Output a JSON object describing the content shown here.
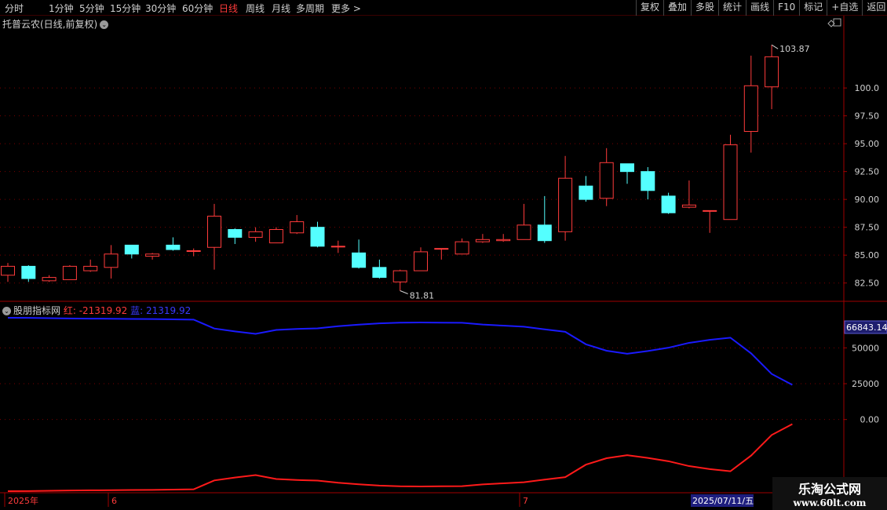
{
  "toolbar": {
    "periods": [
      {
        "label": "分时",
        "active": false
      },
      {
        "label": "1分钟",
        "active": false
      },
      {
        "label": "5分钟",
        "active": false
      },
      {
        "label": "15分钟",
        "active": false
      },
      {
        "label": "30分钟",
        "active": false
      },
      {
        "label": "60分钟",
        "active": false
      },
      {
        "label": "日线",
        "active": true
      },
      {
        "label": "周线",
        "active": false
      },
      {
        "label": "月线",
        "active": false
      },
      {
        "label": "多周期",
        "active": false
      },
      {
        "label": "更多 >",
        "active": false
      }
    ],
    "buttons": [
      "复权",
      "叠加",
      "多股",
      "统计",
      "画线",
      "F10",
      "标记",
      "+自选",
      "返回"
    ]
  },
  "main_title": "托普云农(日线,前复权)",
  "sub_title": {
    "name": "股朋指标网",
    "red_label": "红: -21319.92",
    "blue_label": "蓝: 21319.92"
  },
  "watermark": {
    "line1": "乐淘公式网",
    "line2": "www.60lt.com"
  },
  "colors": {
    "up": "#ff3b3b",
    "down": "#54ffff",
    "blue_line": "#1a1aff",
    "red_line": "#ff1a1a",
    "grid": "#7a0000"
  },
  "chart_data": [
    {
      "type": "candlestick",
      "title": "托普云农(日线,前复权)",
      "ylim": [
        81.0,
        105.5
      ],
      "y_ticks": [
        "100.0",
        "97.50",
        "95.00",
        "92.50",
        "90.00",
        "87.50",
        "85.00",
        "82.50"
      ],
      "high_label": "103.87",
      "low_label": "81.81",
      "candles": [
        {
          "o": 83.2,
          "c": 84.0,
          "h": 84.3,
          "l": 82.6
        },
        {
          "o": 84.0,
          "c": 82.9,
          "h": 84.1,
          "l": 82.6
        },
        {
          "o": 82.7,
          "c": 83.0,
          "h": 83.2,
          "l": 82.6
        },
        {
          "o": 82.8,
          "c": 84.0,
          "h": 84.1,
          "l": 82.8
        },
        {
          "o": 83.6,
          "c": 84.0,
          "h": 84.6,
          "l": 83.5
        },
        {
          "o": 83.9,
          "c": 85.1,
          "h": 85.9,
          "l": 82.9
        },
        {
          "o": 85.9,
          "c": 85.1,
          "h": 85.9,
          "l": 84.7
        },
        {
          "o": 84.9,
          "c": 85.1,
          "h": 85.2,
          "l": 84.6
        },
        {
          "o": 85.9,
          "c": 85.5,
          "h": 86.6,
          "l": 85.4
        },
        {
          "o": 85.4,
          "c": 85.4,
          "h": 85.6,
          "l": 84.9
        },
        {
          "o": 85.7,
          "c": 88.5,
          "h": 89.6,
          "l": 83.7
        },
        {
          "o": 87.3,
          "c": 86.6,
          "h": 87.4,
          "l": 86.0
        },
        {
          "o": 86.6,
          "c": 87.1,
          "h": 87.5,
          "l": 86.2
        },
        {
          "o": 86.1,
          "c": 87.3,
          "h": 87.5,
          "l": 86.1
        },
        {
          "o": 87.0,
          "c": 88.0,
          "h": 88.6,
          "l": 86.9
        },
        {
          "o": 87.5,
          "c": 85.8,
          "h": 88.0,
          "l": 85.7
        },
        {
          "o": 85.8,
          "c": 85.8,
          "h": 86.3,
          "l": 85.2
        },
        {
          "o": 85.2,
          "c": 83.9,
          "h": 86.4,
          "l": 83.8
        },
        {
          "o": 83.9,
          "c": 83.0,
          "h": 84.6,
          "l": 82.9
        },
        {
          "o": 82.6,
          "c": 83.6,
          "h": 83.7,
          "l": 81.81
        },
        {
          "o": 83.6,
          "c": 85.3,
          "h": 85.7,
          "l": 83.6
        },
        {
          "o": 85.6,
          "c": 85.6,
          "h": 85.6,
          "l": 84.6
        },
        {
          "o": 85.1,
          "c": 86.2,
          "h": 86.5,
          "l": 85.1
        },
        {
          "o": 86.2,
          "c": 86.4,
          "h": 86.9,
          "l": 86.1
        },
        {
          "o": 86.3,
          "c": 86.4,
          "h": 86.9,
          "l": 86.2
        },
        {
          "o": 86.4,
          "c": 87.7,
          "h": 89.6,
          "l": 86.4
        },
        {
          "o": 87.7,
          "c": 86.3,
          "h": 90.3,
          "l": 86.1
        },
        {
          "o": 87.1,
          "c": 91.9,
          "h": 93.9,
          "l": 86.3
        },
        {
          "o": 91.2,
          "c": 90.0,
          "h": 92.1,
          "l": 89.8
        },
        {
          "o": 90.1,
          "c": 93.3,
          "h": 94.6,
          "l": 89.4
        },
        {
          "o": 93.2,
          "c": 92.5,
          "h": 93.2,
          "l": 91.4
        },
        {
          "o": 92.5,
          "c": 90.8,
          "h": 92.9,
          "l": 90.0
        },
        {
          "o": 90.3,
          "c": 88.8,
          "h": 90.6,
          "l": 88.7
        },
        {
          "o": 89.3,
          "c": 89.5,
          "h": 91.7,
          "l": 89.2
        },
        {
          "o": 89.0,
          "c": 89.0,
          "h": 89.0,
          "l": 87.0
        },
        {
          "o": 88.2,
          "c": 94.9,
          "h": 95.8,
          "l": 88.2
        },
        {
          "o": 96.1,
          "c": 100.2,
          "h": 102.9,
          "l": 94.2
        },
        {
          "o": 100.1,
          "c": 102.8,
          "h": 103.87,
          "l": 98.1
        }
      ]
    },
    {
      "type": "line",
      "title": "股朋指标网",
      "ylim": [
        -50000,
        71000
      ],
      "y_ticks": [
        "50000",
        "25000",
        "0.00"
      ],
      "current_label": "66843.14",
      "series": [
        {
          "name": "蓝",
          "values": [
            71000,
            70900,
            70700,
            70500,
            70400,
            70300,
            70200,
            70100,
            69900,
            69700,
            63500,
            61500,
            59800,
            62500,
            63200,
            63600,
            65100,
            66200,
            67100,
            67600,
            67700,
            67600,
            67500,
            66300,
            65500,
            64800,
            62900,
            61200,
            52500,
            48000,
            45900,
            47800,
            50100,
            53500,
            55600,
            57100,
            46200,
            31800,
            24200
          ]
        },
        {
          "name": "红",
          "values": [
            -50000,
            -49900,
            -49700,
            -49500,
            -49400,
            -49300,
            -49200,
            -49100,
            -48900,
            -48700,
            -42500,
            -40500,
            -38800,
            -41500,
            -42200,
            -42600,
            -44100,
            -45200,
            -46100,
            -46600,
            -46700,
            -46600,
            -46500,
            -45300,
            -44500,
            -43800,
            -41900,
            -40200,
            -31500,
            -27000,
            -24900,
            -26800,
            -29100,
            -32500,
            -34600,
            -36100,
            -25200,
            -10800,
            -3200
          ]
        }
      ]
    }
  ],
  "date_labels": [
    "2025年",
    "6",
    "7"
  ],
  "date_current": "2025/07/11/五"
}
